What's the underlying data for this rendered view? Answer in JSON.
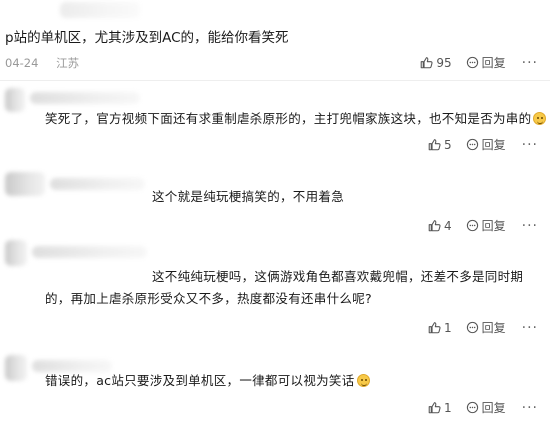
{
  "post": {
    "text": "p站的单机区，尤其涉及到AC的，能给你看笑死",
    "date": "04-24",
    "location": "江苏",
    "likes": "95",
    "reply_label": "回复",
    "more_label": "···"
  },
  "replies": [
    {
      "text": "笑死了，官方视频下面还有求重制虐杀原形的，主打兜帽家族这块，也不知是否为串的",
      "has_emoji": true,
      "likes": "5",
      "reply_label": "回复",
      "more_label": "···"
    },
    {
      "text": "这个就是纯玩梗搞笑的，不用着急",
      "has_emoji": false,
      "likes": "4",
      "reply_label": "回复",
      "more_label": "···"
    },
    {
      "text_line1": "这不纯纯玩梗吗，这俩游戏角色都喜欢戴兜帽，还差不多是同时期",
      "text_line2": "的，再加上虐杀原形受众又不多，热度都没有还串什么呢?",
      "has_emoji": false,
      "likes": "1",
      "reply_label": "回复",
      "more_label": "···"
    },
    {
      "text": "错误的，ac站只要涉及到单机区，一律都可以视为笑话",
      "has_emoji": true,
      "likes": "1",
      "reply_label": "回复",
      "more_label": "···"
    }
  ]
}
